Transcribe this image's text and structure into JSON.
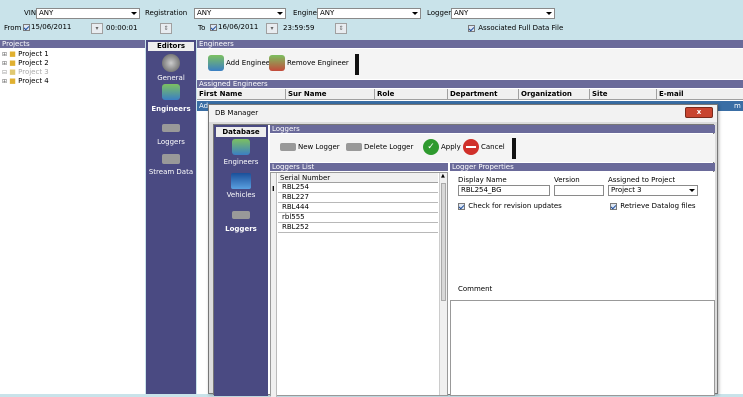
{
  "filters": {
    "vin_label": "VIN",
    "vin_value": "ANY",
    "registration_label": "Registration",
    "registration_value": "ANY",
    "engine_label": "Engine",
    "engine_value": "ANY",
    "logger_label": "Logger",
    "logger_value": "ANY",
    "from_label": "From",
    "from_date": "15/06/2011",
    "from_time": "00:00:01",
    "to_label": "To",
    "to_date": "16/06/2011",
    "to_time": "23:59:59",
    "associated_label": "Associated Full Data File"
  },
  "projects": {
    "header": "Projects",
    "items": [
      "Project 1",
      "Project 2",
      "Project 3",
      "Project 4"
    ]
  },
  "editors": {
    "header": "Editors",
    "items": [
      "General",
      "Engineers",
      "Loggers",
      "Stream Data"
    ]
  },
  "engineers": {
    "header": "Engineers",
    "add_label": "Add Engineer",
    "remove_label": "Remove Engineer",
    "assigned_header": "Assigned Engineers",
    "columns": [
      "First Name",
      "Sur Name",
      "Role",
      "Department",
      "Organization",
      "Site",
      "E-mail"
    ],
    "row_first": "Ad",
    "row_email": "m"
  },
  "dialog": {
    "title": "DB Manager",
    "close": "x",
    "db_header": "Database",
    "db_items": [
      "Engineers",
      "Vehicles",
      "Loggers"
    ],
    "loggers_header": "Loggers",
    "new_logger": "New Logger",
    "delete_logger": "Delete Logger",
    "apply": "Apply",
    "cancel": "Cancel",
    "list_header": "Loggers List",
    "serial_header": "Serial Number",
    "serials": [
      "RBL254",
      "RBL227",
      "RBL444",
      "rbl555",
      "RBL252"
    ],
    "props_header": "Logger Properties",
    "display_name_label": "Display Name",
    "display_name": "RBL254_BG",
    "version_label": "Version",
    "version": "",
    "assigned_label": "Assigned to Project",
    "assigned_value": "Project 3",
    "revision_label": "Check for revision updates",
    "retrieve_label": "Retrieve Datalog files",
    "comment_label": "Comment"
  },
  "colors": {
    "page_bg": "#c9e3ea",
    "sidebar": "#4a4a82",
    "header": "#6a6a9a",
    "selection": "#3a6ea5"
  }
}
